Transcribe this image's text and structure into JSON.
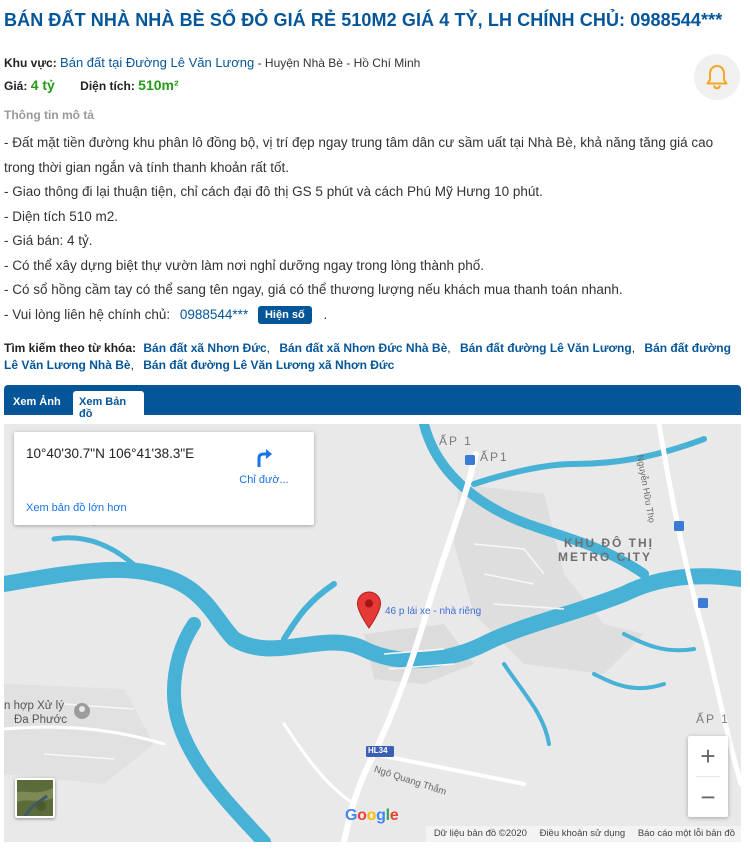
{
  "listing": {
    "title": "BÁN ĐẤT NHÀ NHÀ BÈ SỔ ĐỎ GIÁ RẺ 510M2 GIÁ 4 TỶ, LH CHÍNH CHỦ: 0988544***",
    "area_label": "Khu vực:",
    "area_link": "Bán đất tại Đường Lê Văn Lương",
    "area_rest": " - Huyện Nhà Bè - Hồ Chí Minh",
    "price_label": "Giá:",
    "price_value": "4 tỷ",
    "size_label": "Diện tích:",
    "size_value": "510m²"
  },
  "description": {
    "heading": "Thông tin mô tả",
    "lines": [
      "- Đất mặt tiền đường khu phân lô đồng bộ, vị trí đẹp ngay trung tâm dân cư sầm uất tại Nhà Bè, khả năng tăng giá cao",
      "trong thời gian ngắn và tính thanh khoản rất tốt.",
      "- Giao thông đi lại thuận tiện, chỉ cách đại đô thị GS 5 phút và cách Phú Mỹ Hưng 10 phút.",
      "- Diện tích 510 m2.",
      "- Giá bán: 4 tỷ.",
      "- Có thể xây dựng biệt thự vườn làm nơi nghỉ dưỡng ngay trong lòng thành phố.",
      "- Có sổ hồng cầm tay có thể sang tên ngay, giá có thể thương lượng nếu khách mua thanh toán nhanh."
    ],
    "contact_prefix": "- Vui lòng liên hệ chính chủ:",
    "contact_phone": "0988544***",
    "show_number_button": "Hiện số",
    "contact_suffix": "."
  },
  "keywords": {
    "label": "Tìm kiếm theo từ khóa:",
    "items": [
      "Bán đất xã Nhơn Đức",
      "Bán đất xã Nhơn Đức Nhà Bè",
      "Bán đất đường Lê Văn Lương",
      "Bán đất đường Lê Văn Lương Nhà Bè",
      "Bán đất đường Lê Văn Lương xã Nhơn Đức"
    ]
  },
  "tabs": {
    "photo": "Xem Ảnh",
    "map": "Xem Bản đồ"
  },
  "map": {
    "coords": "10°40'30.7\"N 106°41'38.3\"E",
    "directions": "Chỉ đườ...",
    "bigger_map": "Xem bản đồ lớn hơn",
    "pin_label": "46 p lái xe - nhà riêng",
    "area_name_1": "KHU ĐÔ THỊ",
    "area_name_2": "METRO CITY",
    "place_ap1_a": "ẤP 1",
    "place_ap1_b": "ẤP1",
    "place_ap1_c": "ẤP 1",
    "place_xuly_1": "n hợp Xử lý",
    "place_xuly_2": "Đa Phước",
    "street_nguyen": "Nguyễn Hữu Thọ",
    "street_ngo": "Ngô Quang Thắm",
    "road_badge": "HL34",
    "zoom_in": "+",
    "zoom_out": "−",
    "google_logo": "Google",
    "footer_data": "Dữ liệu bản đồ ©2020",
    "footer_terms": "Điều khoản sử dụng",
    "footer_report": "Báo cáo một lỗi bản đồ"
  },
  "colors": {
    "brand_blue": "#055699",
    "price_green": "#249c17",
    "bell_orange": "#f5a623",
    "pin_red": "#e53935",
    "water": "#47b1d6"
  }
}
